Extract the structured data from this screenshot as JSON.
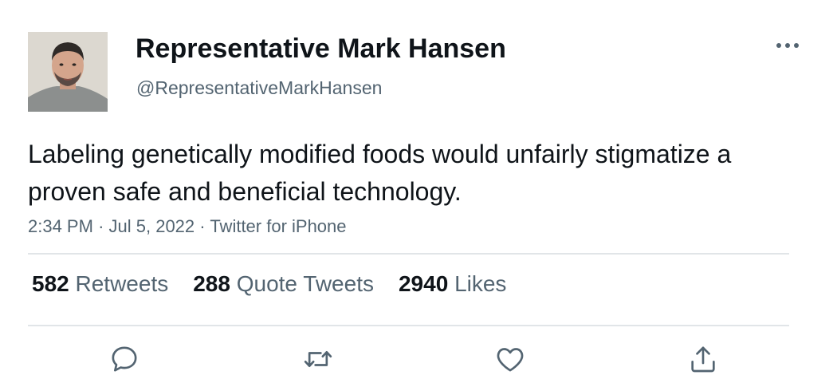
{
  "author": {
    "display_name": "Representative Mark Hansen",
    "handle": "@RepresentativeMarkHansen"
  },
  "tweet": {
    "text": "Labeling genetically modified foods would unfairly stigmatize a proven safe and beneficial technology.",
    "time": "2:34 PM",
    "date": "Jul 5, 2022",
    "source": "Twitter for iPhone",
    "separator": "·"
  },
  "stats": {
    "retweets": {
      "count": "582",
      "label": "Retweets"
    },
    "quotes": {
      "count": "288",
      "label": "Quote Tweets"
    },
    "likes": {
      "count": "2940",
      "label": "Likes"
    }
  },
  "icons": {
    "more": "more-horizontal-icon",
    "reply": "reply-bubble-icon",
    "retweet": "retweet-arrows-icon",
    "like": "heart-icon",
    "share": "share-upload-icon"
  },
  "colors": {
    "text": "#0f1419",
    "secondary": "#536471",
    "divider": "#e1e5e8"
  }
}
